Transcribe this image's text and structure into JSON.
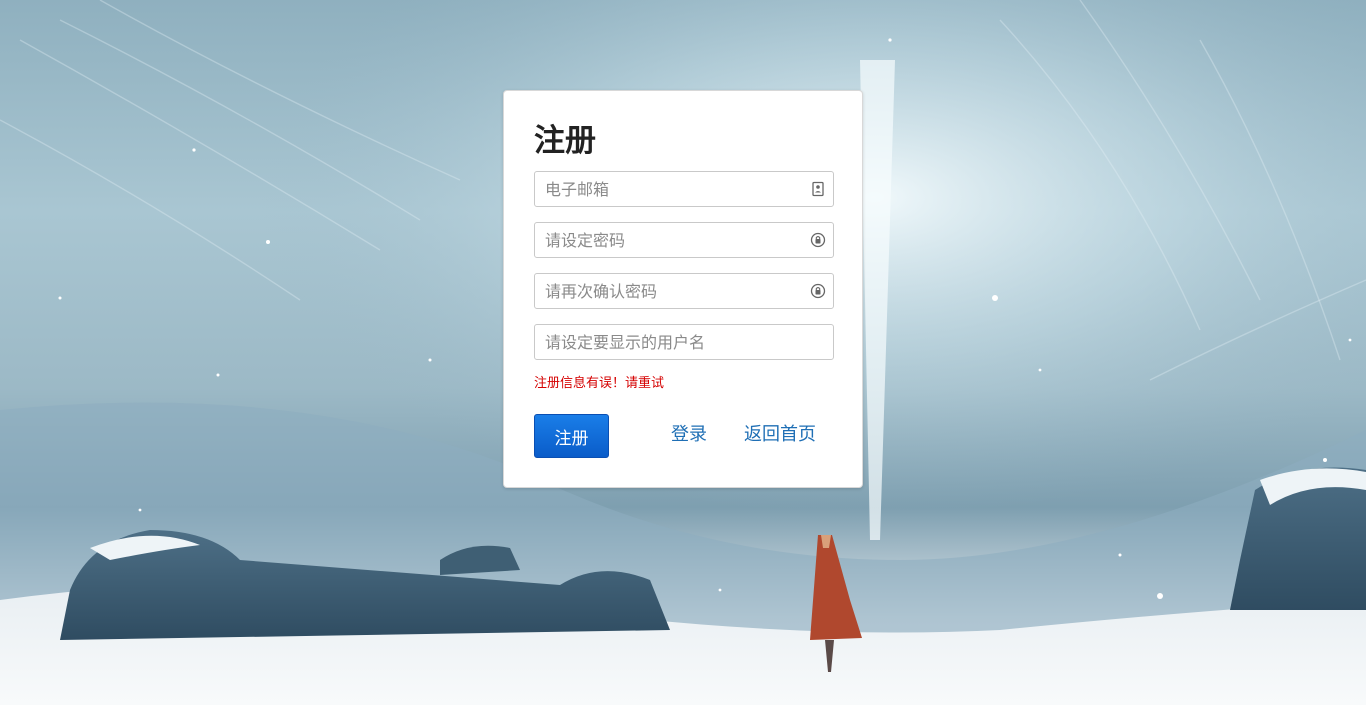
{
  "form": {
    "title": "注册",
    "email_placeholder": "电子邮箱",
    "password_placeholder": "请设定密码",
    "confirm_placeholder": "请再次确认密码",
    "username_placeholder": "请设定要显示的用户名",
    "error_message": "注册信息有误！请重试",
    "register_label": "注册",
    "login_label": "登录",
    "home_label": "返回首页"
  },
  "icons": {
    "email": "contact-card-icon",
    "password": "lock-icon",
    "confirm": "lock-icon"
  },
  "colors": {
    "accent": "#0a5cc9",
    "link": "#1f6fb5",
    "error": "#d50000"
  }
}
